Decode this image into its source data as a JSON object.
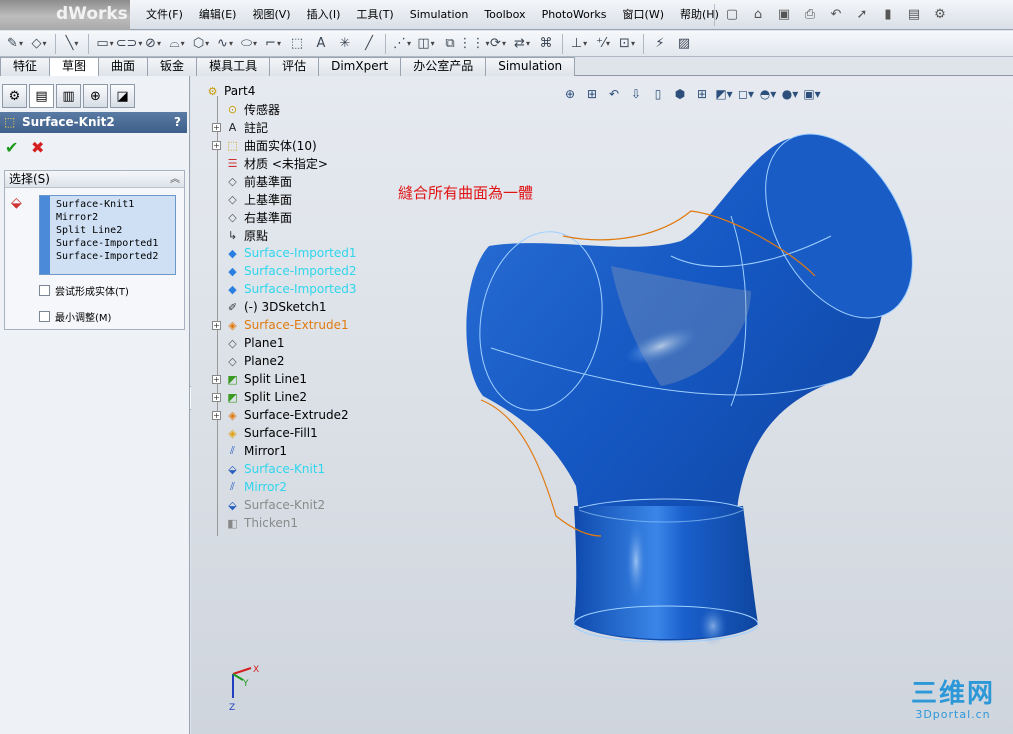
{
  "title_bar": {
    "app_name": "dWorks",
    "menus": [
      "文件(F)",
      "编辑(E)",
      "视图(V)",
      "插入(I)",
      "工具(T)",
      "Simulation",
      "Toolbox",
      "PhotoWorks",
      "窗口(W)",
      "帮助(H)"
    ]
  },
  "tabs": [
    "特征",
    "草图",
    "曲面",
    "钣金",
    "模具工具",
    "评估",
    "DimXpert",
    "办公室产品",
    "Simulation"
  ],
  "active_tab": "草图",
  "property_manager": {
    "title": "Surface-Knit2",
    "help": "?",
    "ok_symbol": "✔",
    "cancel_symbol": "✖",
    "section_title": "选择(S)",
    "selection_items": [
      "Surface-Knit1",
      "Mirror2",
      "Split Line2",
      "Surface-Imported1",
      "Surface-Imported2"
    ],
    "option_try_solid": "尝试形成实体(T)",
    "option_min_adjust": "最小调整(M)"
  },
  "feature_tree": {
    "root": "Part4",
    "items": [
      {
        "label": "传感器",
        "icon": "sensor-icon",
        "color": "#000000",
        "expand": false
      },
      {
        "label": "註記",
        "icon": "annotation-icon",
        "color": "#000000",
        "expand": true
      },
      {
        "label": "曲面实体(10)",
        "icon": "surface-bodies-icon",
        "color": "#000000",
        "expand": true
      },
      {
        "label": "材质 <未指定>",
        "icon": "material-icon",
        "color": "#000000",
        "expand": false
      },
      {
        "label": "前基準面",
        "icon": "plane-icon",
        "color": "#000000",
        "expand": false
      },
      {
        "label": "上基準面",
        "icon": "plane-icon",
        "color": "#000000",
        "expand": false
      },
      {
        "label": "右基準面",
        "icon": "plane-icon",
        "color": "#000000",
        "expand": false
      },
      {
        "label": "原點",
        "icon": "origin-icon",
        "color": "#000000",
        "expand": false
      },
      {
        "label": "Surface-Imported1",
        "icon": "imported-surface-icon",
        "color": "#2fd6ec",
        "expand": false
      },
      {
        "label": "Surface-Imported2",
        "icon": "imported-surface-icon",
        "color": "#2fd6ec",
        "expand": false
      },
      {
        "label": "Surface-Imported3",
        "icon": "imported-surface-icon",
        "color": "#2fd6ec",
        "expand": false
      },
      {
        "label": "(-) 3DSketch1",
        "icon": "3dsketch-icon",
        "color": "#000000",
        "expand": false
      },
      {
        "label": "Surface-Extrude1",
        "icon": "extrude-surface-icon",
        "color": "#e07a10",
        "expand": true
      },
      {
        "label": "Plane1",
        "icon": "plane-icon",
        "color": "#000000",
        "expand": false
      },
      {
        "label": "Plane2",
        "icon": "plane-icon",
        "color": "#000000",
        "expand": false
      },
      {
        "label": "Split Line1",
        "icon": "split-line-icon",
        "color": "#000000",
        "expand": true
      },
      {
        "label": "Split Line2",
        "icon": "split-line-icon",
        "color": "#000000",
        "expand": true
      },
      {
        "label": "Surface-Extrude2",
        "icon": "extrude-surface-icon",
        "color": "#000000",
        "expand": true
      },
      {
        "label": "Surface-Fill1",
        "icon": "fill-surface-icon",
        "color": "#000000",
        "expand": false
      },
      {
        "label": "Mirror1",
        "icon": "mirror-icon",
        "color": "#000000",
        "expand": false
      },
      {
        "label": "Surface-Knit1",
        "icon": "knit-icon",
        "color": "#2fd6ec",
        "expand": false
      },
      {
        "label": "Mirror2",
        "icon": "mirror-icon",
        "color": "#2fd6ec",
        "expand": false
      },
      {
        "label": "Surface-Knit2",
        "icon": "knit-icon",
        "color": "#8a8a8a",
        "expand": false
      },
      {
        "label": "Thicken1",
        "icon": "thicken-icon",
        "color": "#8a8a8a",
        "expand": false
      }
    ]
  },
  "annotation_text": "縫合所有曲面為一體",
  "triad": {
    "x": "X",
    "y": "Y",
    "z": "Z"
  },
  "watermark": {
    "big": "三维网",
    "small": "3Dportal.cn"
  },
  "colors": {
    "model_blue": "#1b5fc7",
    "highlight_cyan": "#2fd6ec",
    "orange": "#e07a10"
  }
}
